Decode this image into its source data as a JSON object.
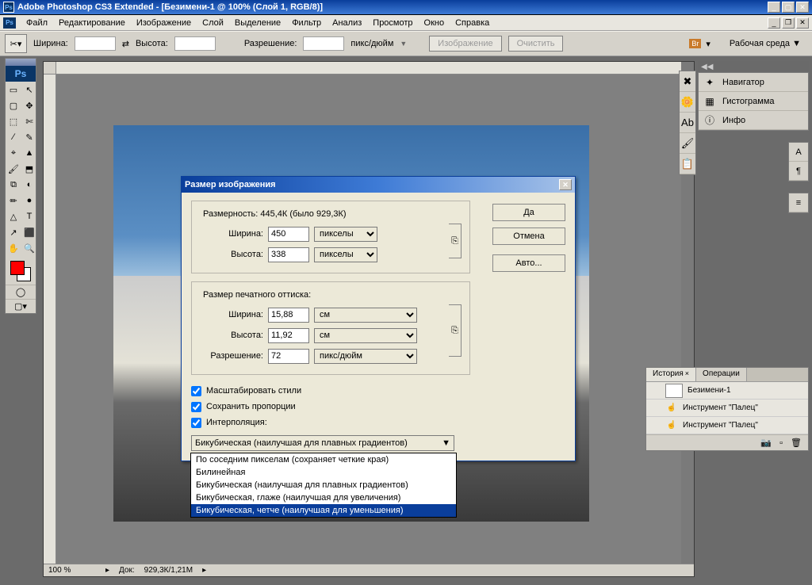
{
  "titlebar": {
    "app_icon": "Ps",
    "title": "Adobe Photoshop CS3 Extended - [Безимени-1 @ 100% (Слой 1, RGB/8)]"
  },
  "menubar": {
    "ps_icon": "Ps",
    "items": [
      "Файл",
      "Редактирование",
      "Изображение",
      "Слой",
      "Выделение",
      "Фильтр",
      "Анализ",
      "Просмотр",
      "Окно",
      "Справка"
    ]
  },
  "optionsbar": {
    "width_label": "Ширина:",
    "height_label": "Высота:",
    "swap": "⇄",
    "res_label": "Разрешение:",
    "res_unit": "пикс/дюйм",
    "btn_image": "Изображение",
    "btn_clear": "Очистить",
    "workspace_label": "Рабочая среда ▼"
  },
  "status": {
    "zoom": "100 %",
    "doc_label": "Док:",
    "doc_info": "929,3К/1,21М"
  },
  "right_dock": {
    "items": [
      {
        "icon": "✦",
        "label": "Навигатор"
      },
      {
        "icon": "▦",
        "label": "Гистограмма"
      },
      {
        "icon": "ⓘ",
        "label": "Инфо"
      }
    ]
  },
  "mini_icons": [
    "A",
    "¶",
    "",
    "≡"
  ],
  "side_icons": [
    "✖",
    "🌼",
    "Ab",
    "🖌",
    "📋"
  ],
  "history_panel": {
    "tabs": [
      "История",
      "Операции"
    ],
    "doc_name": "Безимени-1",
    "rows": [
      {
        "icon": "☝",
        "label": "Инструмент \"Палец\""
      },
      {
        "icon": "☝",
        "label": "Инструмент \"Палец\""
      }
    ]
  },
  "dialog": {
    "title": "Размер изображения",
    "dim_label_prefix": "Размерность:",
    "dim_value": "445,4К (было 929,3К)",
    "px_width_label": "Ширина:",
    "px_width": "450",
    "px_height_label": "Высота:",
    "px_height": "338",
    "unit_pixels": "пикселы",
    "print_legend": "Размер печатного оттиска:",
    "pr_width_label": "Ширина:",
    "pr_width": "15,88",
    "pr_height_label": "Высота:",
    "pr_height": "11,92",
    "unit_cm": "см",
    "res_label": "Разрешение:",
    "res_value": "72",
    "res_unit": "пикс/дюйм",
    "chk_styles": "Масштабировать стили",
    "chk_constrain": "Сохранить пропорции",
    "chk_interp": "Интерполяция:",
    "interp_value": "Бикубическая (наилучшая для плавных градиентов)",
    "btn_ok": "Да",
    "btn_cancel": "Отмена",
    "btn_auto": "Авто...",
    "dropdown": [
      "По соседним пикселам (сохраняет четкие края)",
      "Билинейная",
      "Бикубическая (наилучшая для плавных градиентов)",
      "Бикубическая, глаже (наилучшая для увеличения)",
      "Бикубическая, четче (наилучшая для уменьшения)"
    ],
    "dropdown_selected": 4
  },
  "tools": [
    "▭",
    "↖",
    "▢",
    "✥",
    "⬚",
    "✄",
    "∕",
    "✎",
    "⌖",
    "▲",
    "🖌",
    "⬒",
    "⧉",
    "◐",
    "✏",
    "●",
    "△",
    "T",
    "↗",
    "⬛",
    "✋",
    "🔍"
  ],
  "colors": {
    "fg": "#ff0000",
    "bg": "#ffffff"
  }
}
